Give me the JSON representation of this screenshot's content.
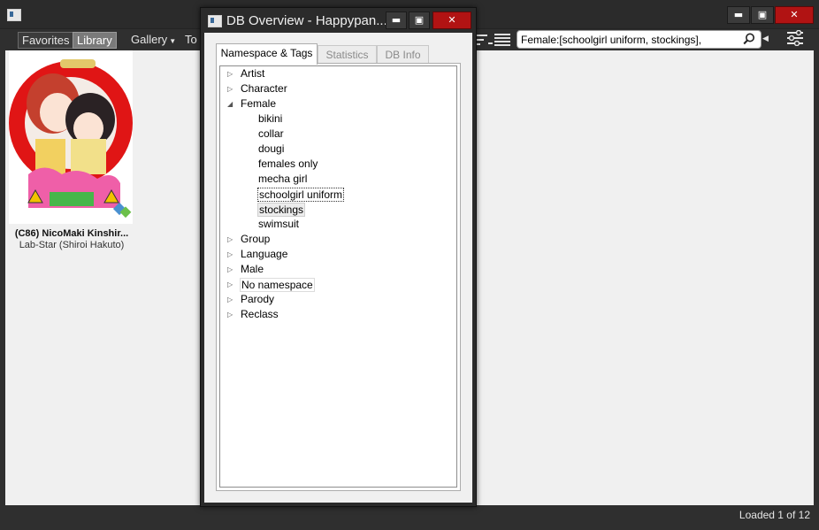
{
  "main": {
    "toolbar": {
      "favorites": "Favorites",
      "library": "Library",
      "gallery": "Gallery",
      "tools_partial": "To"
    },
    "search": {
      "value": "Female:[schoolgirl uniform, stockings],"
    },
    "gallery_card": {
      "title": "(C86)  NicoMaki Kinshir...",
      "artist": "Lab-Star (Shiroi Hakuto)"
    },
    "status": "Loaded 1 of 12"
  },
  "dialog": {
    "title": "DB Overview - Happypan...",
    "tabs": [
      {
        "label": "Namespace & Tags"
      },
      {
        "label": "Statistics"
      },
      {
        "label": "DB Info"
      }
    ],
    "tree": [
      {
        "label": "Artist",
        "expanded": false
      },
      {
        "label": "Character",
        "expanded": false
      },
      {
        "label": "Female",
        "expanded": true
      },
      {
        "label": "bikini"
      },
      {
        "label": "collar"
      },
      {
        "label": "dougi"
      },
      {
        "label": "females only"
      },
      {
        "label": "mecha girl"
      },
      {
        "label": "schoolgirl uniform",
        "selected": true
      },
      {
        "label": "stockings",
        "selected": true
      },
      {
        "label": "swimsuit"
      },
      {
        "label": "Group",
        "expanded": false
      },
      {
        "label": "Language",
        "expanded": false
      },
      {
        "label": "Male",
        "expanded": false
      },
      {
        "label": "No namespace",
        "expanded": false
      },
      {
        "label": "Parody",
        "expanded": false
      },
      {
        "label": "Reclass",
        "expanded": false
      }
    ]
  },
  "colors": {
    "close_button": "#b11313",
    "dark_chrome": "#2f2f2f"
  }
}
